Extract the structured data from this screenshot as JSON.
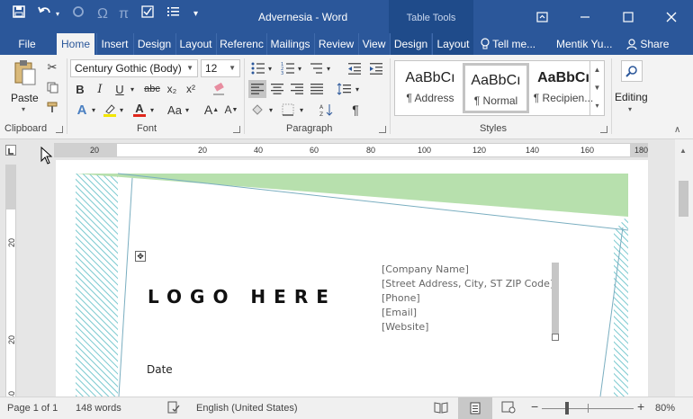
{
  "window": {
    "title": "Advernesia - Word",
    "table_tools": "Table Tools"
  },
  "qat": {
    "save_icon": "save-icon",
    "undo_icon": "undo-icon",
    "redo_icon": "redo-icon",
    "omega_icon": "omega-icon",
    "pi_icon": "pi-icon"
  },
  "tabs": [
    {
      "label": "File"
    },
    {
      "label": "Home"
    },
    {
      "label": "Insert"
    },
    {
      "label": "Design"
    },
    {
      "label": "Layout"
    },
    {
      "label": "Referenc"
    },
    {
      "label": "Mailings"
    },
    {
      "label": "Review"
    },
    {
      "label": "View"
    },
    {
      "label": "Design"
    },
    {
      "label": "Layout"
    }
  ],
  "tell_me": "Tell me...",
  "user": "Mentik Yu...",
  "share": "Share",
  "ribbon": {
    "clipboard": {
      "label": "Clipboard",
      "paste": "Paste"
    },
    "font": {
      "label": "Font",
      "family": "Century Gothic (Body)",
      "size": "12"
    },
    "paragraph": {
      "label": "Paragraph"
    },
    "styles": {
      "label": "Styles",
      "items": [
        {
          "sample": "AaBbCı",
          "name": "¶ Address"
        },
        {
          "sample": "AaBbCı",
          "name": "¶ Normal"
        },
        {
          "sample": "AaBbCı",
          "name": "¶ Recipien..."
        }
      ]
    },
    "editing": {
      "label": "Editing"
    }
  },
  "ruler": {
    "h_ticks": [
      "20",
      "20",
      "40",
      "60",
      "80",
      "100",
      "120",
      "140",
      "160",
      "180"
    ],
    "v_ticks": [
      "20",
      "20",
      "40"
    ]
  },
  "document": {
    "logo": "LOGO HERE",
    "company_lines": [
      "[Company Name]",
      "[Street Address, City, ST ZIP Code]",
      "[Phone]",
      "[Email]",
      "[Website]"
    ],
    "date": "Date"
  },
  "status": {
    "page": "Page 1 of 1",
    "words": "148 words",
    "language": "English (United States)",
    "zoom": "80%",
    "zoom_level": 0.8
  },
  "colors": {
    "brand": "#2b579a",
    "accent_green": "#b7e0ad",
    "accent_teal": "#7ac9cf"
  }
}
